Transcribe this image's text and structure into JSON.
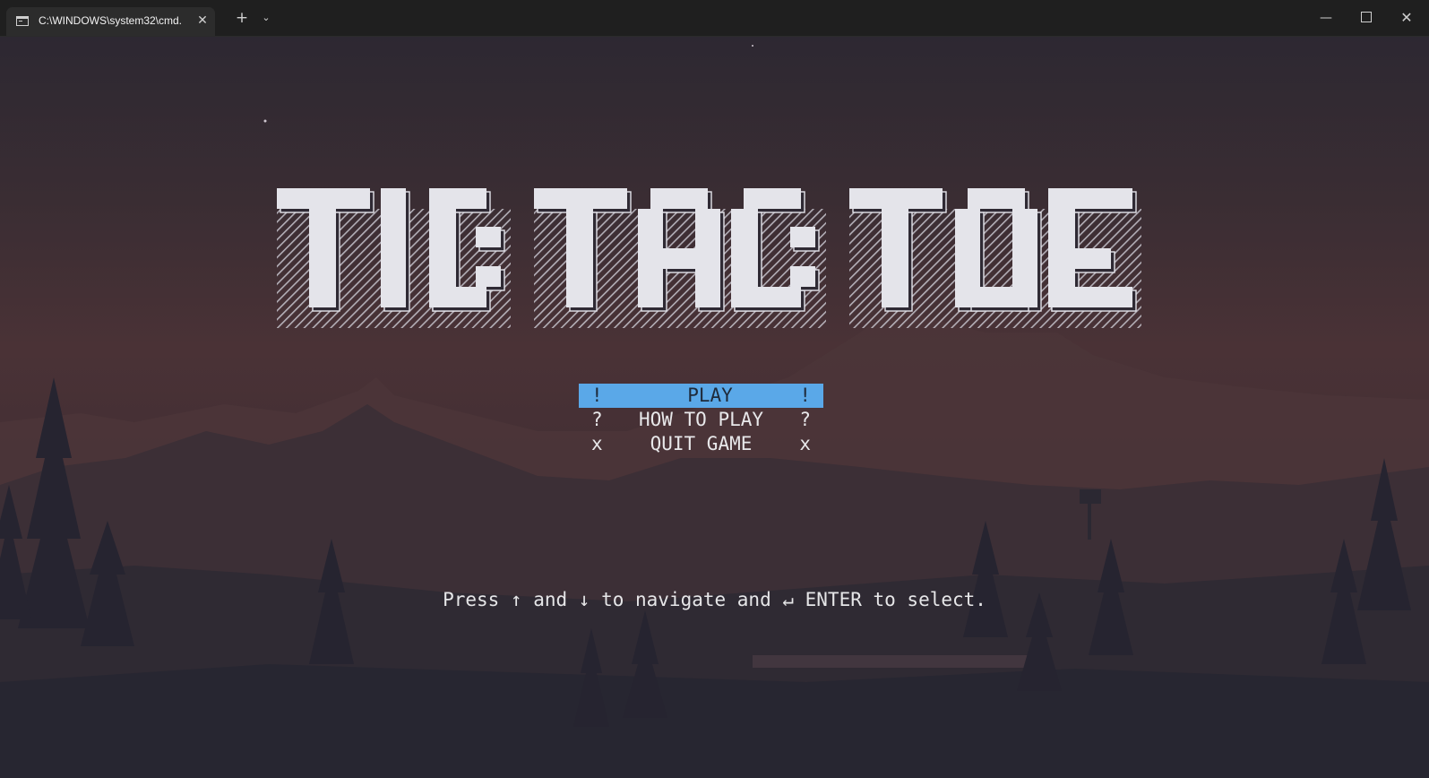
{
  "window": {
    "tab_title": "C:\\WINDOWS\\system32\\cmd.",
    "tab_icon": "terminal-icon",
    "close_tab_glyph": "✕",
    "new_tab_glyph": "+",
    "dropdown_glyph": "⌄",
    "minimize_glyph": "—",
    "close_glyph": "✕"
  },
  "game": {
    "title_art": "TIC TAC TOE",
    "menu": [
      {
        "label": "PLAY",
        "marker": "!",
        "selected": true
      },
      {
        "label": "HOW TO PLAY",
        "marker": "?",
        "selected": false
      },
      {
        "label": "QUIT GAME",
        "marker": "x",
        "selected": false
      }
    ],
    "hint": "Press ↑ and ↓ to navigate and ↵ ENTER to select."
  },
  "colors": {
    "highlight": "#5aa8e8",
    "text": "#e8e8ea",
    "block": "#e4e4ea"
  }
}
